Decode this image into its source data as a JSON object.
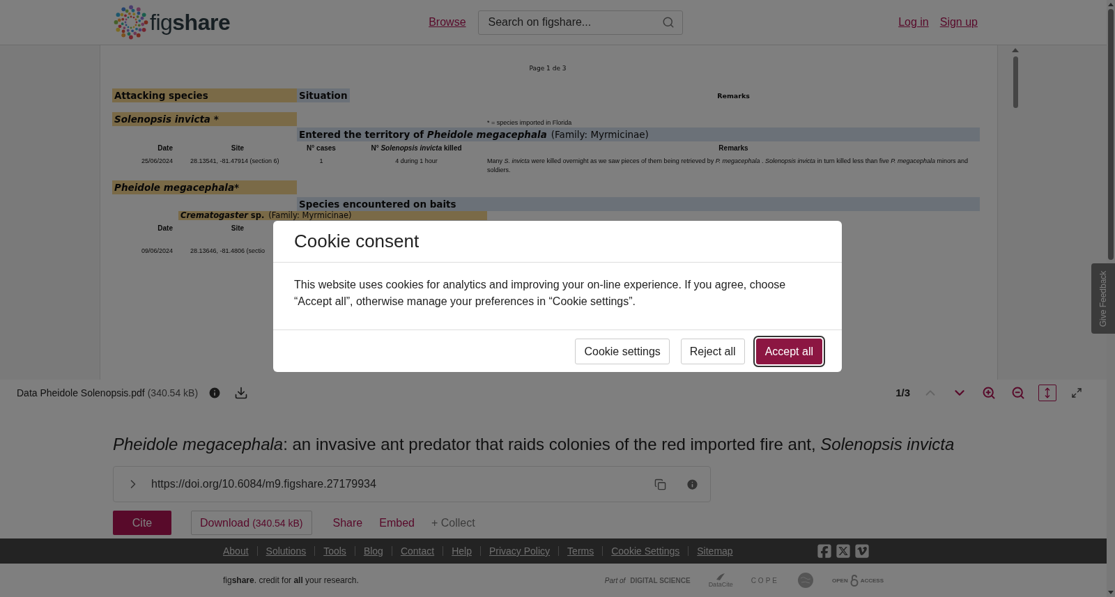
{
  "header": {
    "logo": "fig**share**",
    "nav_link": "Browse",
    "search": {
      "placeholder": "Search on figshare..."
    },
    "account_links": [
      "Log in",
      "Sign up"
    ]
  },
  "document": {
    "page_label": "Page 1 de 3",
    "rows": [
      {
        "kind": "heading",
        "species": {
          "text": "Attacking species",
          "italic": false
        },
        "situation": "Situation",
        "remarks": "Remarks"
      },
      {
        "kind": "species",
        "species": {
          "text": "Solenopsis invicta *",
          "italic": true
        },
        "footnote": "* =  species imported in Florida"
      },
      {
        "kind": "section",
        "text": "Entered the territory of *Pheidole megacephala*",
        "note": "(Family: Myrmicinae)"
      },
      {
        "kind": "columns",
        "cells": [
          "Date",
          "Site",
          "N° cases",
          "N° *Solenopsis invicta* killed",
          "Remarks"
        ]
      },
      {
        "kind": "record",
        "cells": [
          "25/06/2024",
          "28.13541, -81.47914 (section 6)",
          "1",
          "4 during 1 hour",
          "Many *S. invicta* were killed overnight as we saw pieces of them being retrieved by *P. megacephala* . *Solenopsis invicta* in turn killed less than five *P. megacephala* minors and soldiers."
        ]
      },
      {
        "kind": "species",
        "species": {
          "text": "Pheidole megacephala*",
          "italic": true
        }
      },
      {
        "kind": "section",
        "text": "Species encountered on baits"
      },
      {
        "kind": "subspecies",
        "text": "*Crematogaster* sp.",
        "note": "(Family: Myrmicinae)"
      },
      {
        "kind": "columns",
        "cells": [
          "Date",
          "Site"
        ]
      },
      {
        "kind": "record",
        "cells": [
          "09/06/2024",
          "28.13646, -81.4806 (sectio"
        ]
      }
    ]
  },
  "viewer_toolbar": {
    "file_name": "Data Pheidole Solenopsis.pdf",
    "file_size": "(340.54 kB)",
    "page_indicator": "1/3",
    "prev_disabled": true,
    "next_disabled": false,
    "fit_selected": true
  },
  "feedback_tab": "Give Feedback",
  "item": {
    "title": "*Pheidole megacephala*: an invasive ant predator that raids colonies of the red imported fire ant, *Solenopsis invicta*",
    "doi": "https://doi.org/10.6084/m9.figshare.27179934",
    "actions": [
      {
        "kind": "primary",
        "label": "Cite"
      },
      {
        "kind": "outline",
        "label": "Download",
        "size": "(340.54 kB)"
      },
      {
        "kind": "link",
        "label": "Share"
      },
      {
        "kind": "link",
        "label": "Embed"
      },
      {
        "kind": "muted",
        "label": "+ Collect"
      }
    ]
  },
  "footer": {
    "links": [
      "About",
      "Solutions",
      "Tools",
      "Blog",
      "Contact",
      "Help",
      "Privacy Policy",
      "Terms",
      "Cookie Settings",
      "Sitemap"
    ],
    "social": [
      {
        "kind": "facebook"
      },
      {
        "kind": "x"
      },
      {
        "kind": "vimeo"
      }
    ],
    "tagline": "fig**share**. credit for **all** your research.",
    "partners": [
      {
        "kind": "digital-science",
        "prefix": "Part of",
        "label": "DIGITAL SCIENCE"
      },
      {
        "kind": "datacite",
        "label": "DataCite"
      },
      {
        "kind": "cope",
        "label": "COPE"
      },
      {
        "kind": "globe"
      },
      {
        "kind": "open-access",
        "label": "OPEN ACCESS"
      }
    ]
  },
  "cookie_dialog": {
    "title": "Cookie consent",
    "body": "This website uses cookies for analytics and improving your on-line experience. If you agree, choose “Accept all”, otherwise manage your preferences in “Cookie settings”.",
    "buttons": [
      {
        "kind": "secondary",
        "label": "Cookie settings"
      },
      {
        "kind": "secondary",
        "label": "Reject all"
      },
      {
        "kind": "primary",
        "label": "Accept all"
      }
    ]
  }
}
